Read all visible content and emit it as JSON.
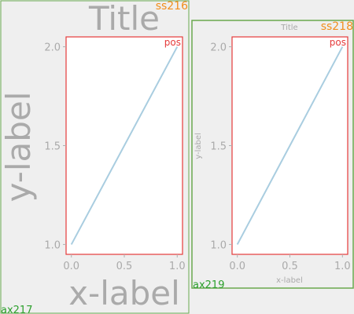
{
  "colors": {
    "background": "#efefef",
    "text_gray": "#aaaaaa",
    "line": "#a9cde0",
    "pos_box": "#e53a3a",
    "subfigure_label": "#f28e1c",
    "axes_label": "#2ca02c",
    "subfigure_box": "#6aa84f"
  },
  "figure": {
    "left_subfigure_label": "ss216",
    "right_subfigure_label": "ss218",
    "left_axes_label": "ax217",
    "right_axes_label": "ax219"
  },
  "chart_data": [
    {
      "type": "line",
      "title": "Title",
      "xlabel": "x-label",
      "ylabel": "y-label",
      "position_label": "pos",
      "x": [
        0,
        1
      ],
      "series": [
        {
          "values": [
            1,
            2
          ]
        }
      ],
      "xlim": [
        -0.05,
        1.05
      ],
      "ylim": [
        0.95,
        2.05
      ],
      "xticks": [
        0,
        0.5,
        1
      ],
      "xtick_labels": [
        "0.0",
        "0.5",
        "1.0"
      ],
      "yticks": [
        1,
        1.5,
        2
      ],
      "ytick_labels": [
        "1.0",
        "1.5",
        "2.0"
      ],
      "grid": false
    },
    {
      "type": "line",
      "title": "Title",
      "xlabel": "x-label",
      "ylabel": "y-label",
      "position_label": "pos",
      "x": [
        0,
        1
      ],
      "series": [
        {
          "values": [
            1,
            2
          ]
        }
      ],
      "xlim": [
        -0.05,
        1.05
      ],
      "ylim": [
        0.95,
        2.05
      ],
      "xticks": [
        0,
        0.5,
        1
      ],
      "xtick_labels": [
        "0.0",
        "0.5",
        "1.0"
      ],
      "yticks": [
        1,
        1.5,
        2
      ],
      "ytick_labels": [
        "1.0",
        "1.5",
        "2.0"
      ],
      "grid": false
    }
  ]
}
